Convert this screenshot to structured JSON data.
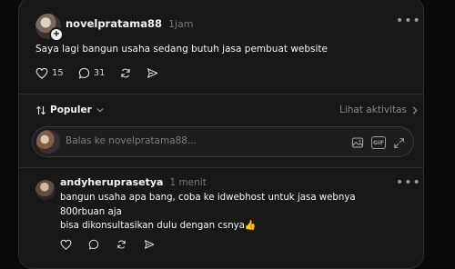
{
  "post": {
    "username": "novelpratama88",
    "time": "1jam",
    "text": "Saya lagi bangun usaha sedang butuh jasa pembuat website",
    "likes": "15",
    "comments": "31",
    "more_icon": "more-horizontal-icon"
  },
  "sort": {
    "label": "Populer",
    "activity_label": "Lihat aktivitas"
  },
  "reply_box": {
    "placeholder": "Balas ke novelpratama88..."
  },
  "comment": {
    "username": "andyheruprasetya",
    "time": "1 menit",
    "lines": [
      "bangun usaha apa bang, coba ke idwebhost untuk jasa webnya",
      "800rbuan aja",
      "bisa dikonsultasikan dulu dengan csnya👍"
    ]
  },
  "gif_label": "GIF"
}
